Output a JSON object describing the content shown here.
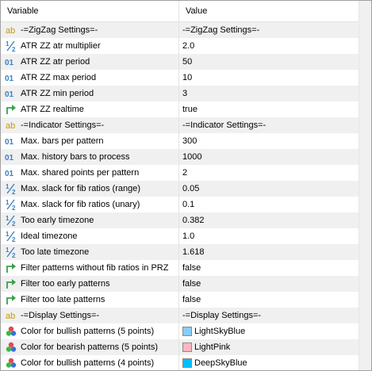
{
  "header": {
    "variable": "Variable",
    "value": "Value"
  },
  "rows": [
    {
      "icon": "string-icon",
      "name": "-=ZigZag Settings=-",
      "value": "-=ZigZag Settings=-"
    },
    {
      "icon": "fraction-icon",
      "name": "ATR ZZ atr multiplier",
      "value": "2.0"
    },
    {
      "icon": "integer-icon",
      "name": "ATR ZZ atr period",
      "value": "50"
    },
    {
      "icon": "integer-icon",
      "name": "ATR ZZ max period",
      "value": "10"
    },
    {
      "icon": "integer-icon",
      "name": "ATR ZZ min period",
      "value": "3"
    },
    {
      "icon": "bool-arrow-icon",
      "name": "ATR ZZ realtime",
      "value": "true"
    },
    {
      "icon": "string-icon",
      "name": "-=Indicator Settings=-",
      "value": "-=Indicator Settings=-"
    },
    {
      "icon": "integer-icon",
      "name": "Max. bars per pattern",
      "value": "300"
    },
    {
      "icon": "integer-icon",
      "name": "Max. history bars to process",
      "value": "1000"
    },
    {
      "icon": "integer-icon",
      "name": "Max. shared points per pattern",
      "value": "2"
    },
    {
      "icon": "fraction-icon",
      "name": "Max. slack for fib ratios (range)",
      "value": "0.05"
    },
    {
      "icon": "fraction-icon",
      "name": "Max. slack for fib ratios (unary)",
      "value": "0.1"
    },
    {
      "icon": "fraction-icon",
      "name": "Too early timezone",
      "value": "0.382"
    },
    {
      "icon": "fraction-icon",
      "name": "Ideal timezone",
      "value": "1.0"
    },
    {
      "icon": "fraction-icon",
      "name": "Too late timezone",
      "value": "1.618"
    },
    {
      "icon": "bool-arrow-icon",
      "name": "Filter patterns without fib ratios in PRZ",
      "value": "false"
    },
    {
      "icon": "bool-arrow-icon",
      "name": "Filter too early patterns",
      "value": "false"
    },
    {
      "icon": "bool-arrow-icon",
      "name": "Filter too late patterns",
      "value": "false"
    },
    {
      "icon": "string-icon",
      "name": "-=Display Settings=-",
      "value": "-=Display Settings=-"
    },
    {
      "icon": "color-icon",
      "name": "Color for bullish patterns (5 points)",
      "value": "LightSkyBlue",
      "swatch": "#87cefa"
    },
    {
      "icon": "color-icon",
      "name": "Color for bearish patterns (5 points)",
      "value": "LightPink",
      "swatch": "#ffb6c1"
    },
    {
      "icon": "color-icon",
      "name": "Color for bullish patterns (4 points)",
      "value": "DeepSkyBlue",
      "swatch": "#00bfff"
    }
  ],
  "colors": {
    "string": "#c79a00",
    "fraction": "#3b7fc4",
    "integer": "#3b7fc4",
    "bool": "#3aa04a"
  }
}
